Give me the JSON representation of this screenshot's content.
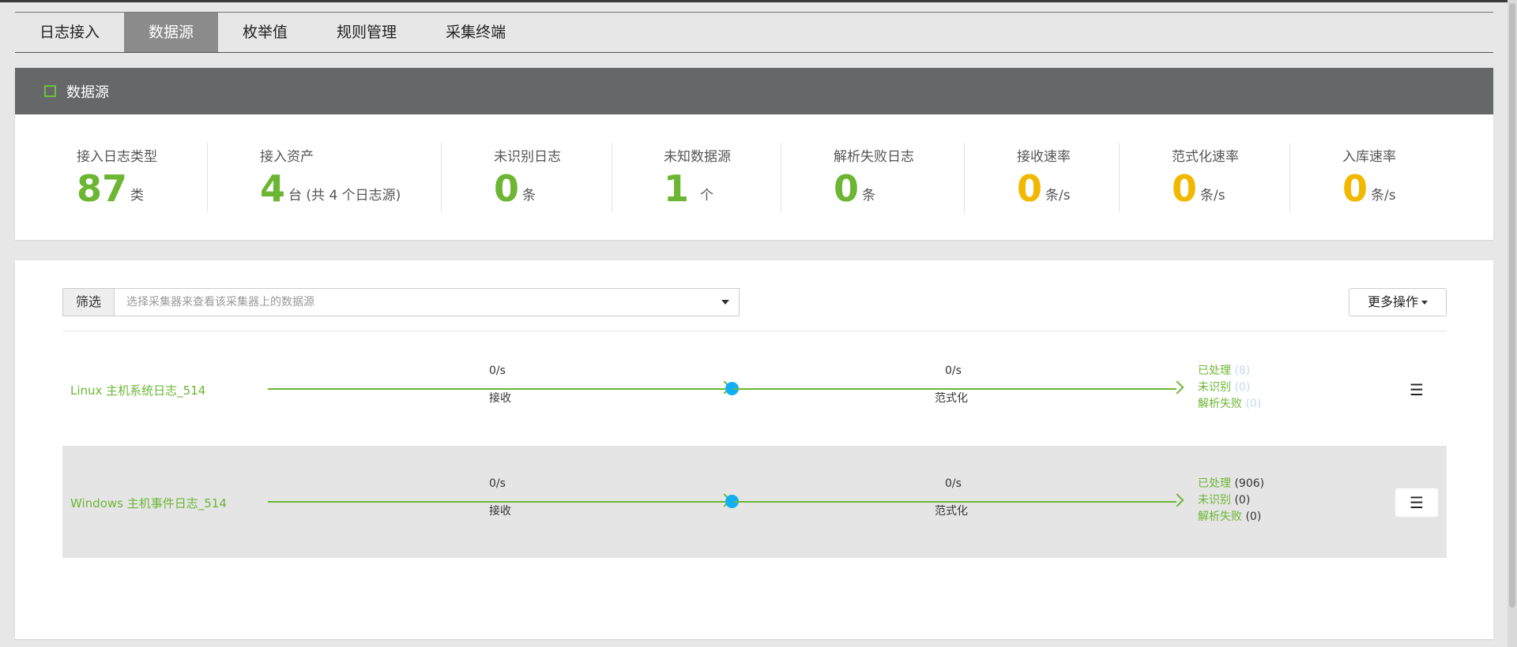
{
  "tabs": [
    {
      "label": "日志接入",
      "active": false
    },
    {
      "label": "数据源",
      "active": true
    },
    {
      "label": "枚举值",
      "active": false
    },
    {
      "label": "规则管理",
      "active": false
    },
    {
      "label": "采集终端",
      "active": false
    }
  ],
  "header": {
    "title": "数据源"
  },
  "stats": [
    {
      "label": "接入日志类型",
      "value": "87",
      "unit": "类",
      "color": "green"
    },
    {
      "label": "接入资产",
      "value": "4",
      "unit": "台 (共 4 个日志源)",
      "color": "green"
    },
    {
      "label": "未识别日志",
      "value": "0",
      "unit": "条",
      "color": "green"
    },
    {
      "label": "未知数据源",
      "value": "1",
      "unit": "个",
      "color": "green"
    },
    {
      "label": "解析失败日志",
      "value": "0",
      "unit": "条",
      "color": "green"
    },
    {
      "label": "接收速率",
      "value": "0",
      "unit": "条/s",
      "color": "yellow"
    },
    {
      "label": "范式化速率",
      "value": "0",
      "unit": "条/s",
      "color": "yellow"
    },
    {
      "label": "入库速率",
      "value": "0",
      "unit": "条/s",
      "color": "yellow"
    }
  ],
  "filter": {
    "label": "筛选",
    "placeholder": "选择采集器来查看该采集器上的数据源"
  },
  "more_actions": {
    "label": "更多操作"
  },
  "rows": [
    {
      "name": "Linux 主机系统日志_514",
      "receive_rate": "0/s",
      "receive_label": "接收",
      "normalize_rate": "0/s",
      "normalize_label": "范式化",
      "processed_label": "已处理",
      "processed_count": "(8)",
      "unrecognized_label": "未识别",
      "unrecognized_count": "(0)",
      "failed_label": "解析失败",
      "failed_count": "(0)"
    },
    {
      "name": "Windows 主机事件日志_514",
      "receive_rate": "0/s",
      "receive_label": "接收",
      "normalize_rate": "0/s",
      "normalize_label": "范式化",
      "processed_label": "已处理",
      "processed_count": "(906)",
      "unrecognized_label": "未识别",
      "unrecognized_count": "(0)",
      "failed_label": "解析失败",
      "failed_count": "(0)"
    }
  ],
  "colors": {
    "accent_green": "#6cb634",
    "accent_yellow": "#f2b800",
    "node_blue": "#11b0f5",
    "header_gray": "#666769"
  },
  "icons": {
    "menu": "hamburger-menu-icon",
    "dropdown": "caret-down-icon",
    "header_marker": "square-outline-icon"
  }
}
